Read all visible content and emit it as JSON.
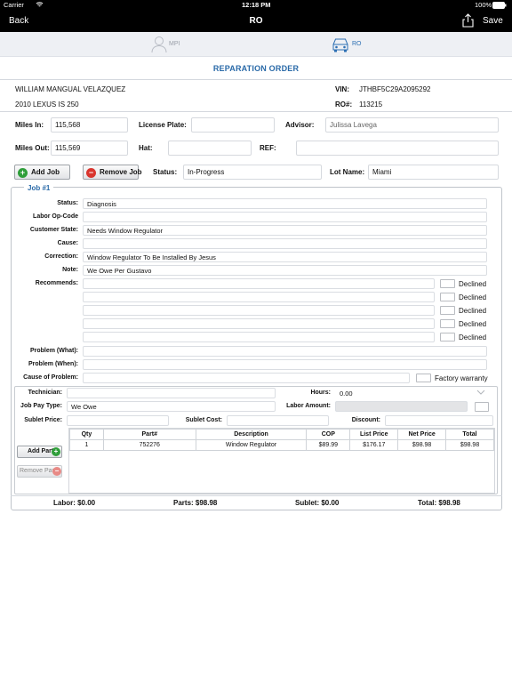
{
  "status_bar": {
    "carrier": "Carrier",
    "time": "12:18 PM",
    "battery": "100%"
  },
  "nav": {
    "back_label": "Back",
    "title": "RO",
    "save_label": "Save"
  },
  "tabs": {
    "mpi": "MPI",
    "ro": "RO"
  },
  "page_title": "REPARATION ORDER",
  "customer": {
    "name": "WILLIAM MANGUAL VELAZQUEZ",
    "vehicle": "2010 LEXUS IS 250",
    "vin_label": "VIN:",
    "vin": "JTHBF5C29A2095292",
    "ro_label": "RO#:",
    "ro_number": "113215"
  },
  "form": {
    "miles_in_label": "Miles In:",
    "miles_in": "115,568",
    "license_plate_label": "License Plate:",
    "license_plate": "",
    "advisor_label": "Advisor:",
    "advisor": "Julissa Lavega",
    "miles_out_label": "Miles Out:",
    "miles_out": "115,569",
    "hat_label": "Hat:",
    "hat": "",
    "ref_label": "REF:",
    "ref": "",
    "add_job_label": "Add Job",
    "remove_job_label": "Remove Job",
    "status_label": "Status:",
    "status": "In-Progress",
    "lot_name_label": "Lot Name:",
    "lot_name": "Miami"
  },
  "job": {
    "title": "Job #1",
    "status_label": "Status:",
    "status": "Diagnosis",
    "labor_op_label": "Labor Op-Code",
    "labor_op": "",
    "customer_state_label": "Customer State:",
    "customer_state": "Needs Window Regulator",
    "cause_label": "Cause:",
    "cause": "",
    "correction_label": "Correction:",
    "correction": "Window Regulator To Be Installed By Jesus",
    "note_label": "Note:",
    "note": "We Owe Per Gustavo",
    "recommends_label": "Recommends:",
    "declined_label": "Declined",
    "problem_what_label": "Problem (What):",
    "problem_when_label": "Problem (When):",
    "cause_of_problem_label": "Cause of Problem:",
    "factory_warranty_label": "Factory warranty",
    "technician_label": "Technician:",
    "technician": "",
    "hours_label": "Hours:",
    "hours": "0.00",
    "job_pay_type_label": "Job Pay Type:",
    "job_pay_type": "We Owe",
    "labor_amount_label": "Labor Amount:",
    "sublet_price_label": "Sublet Price:",
    "sublet_cost_label": "Sublet Cost:",
    "discount_label": "Discount:",
    "add_part_label": "Add Part",
    "remove_part_label": "Remove Part"
  },
  "parts_table": {
    "headers": [
      "Qty",
      "Part#",
      "Description",
      "COP",
      "List Price",
      "Net Price",
      "Total"
    ],
    "rows": [
      [
        "1",
        "752276",
        "Window Regulator",
        "$89.99",
        "$176.17",
        "$98.98",
        "$98.98"
      ]
    ]
  },
  "totals": {
    "labor": "Labor: $0.00",
    "parts": "Parts: $98.98",
    "sublet": "Sublet: $0.00",
    "total": "Total: $98.98"
  },
  "colors": {
    "accent": "#2a6aa8",
    "add_green": "#2f9e3a",
    "remove_red": "#d9352e"
  }
}
